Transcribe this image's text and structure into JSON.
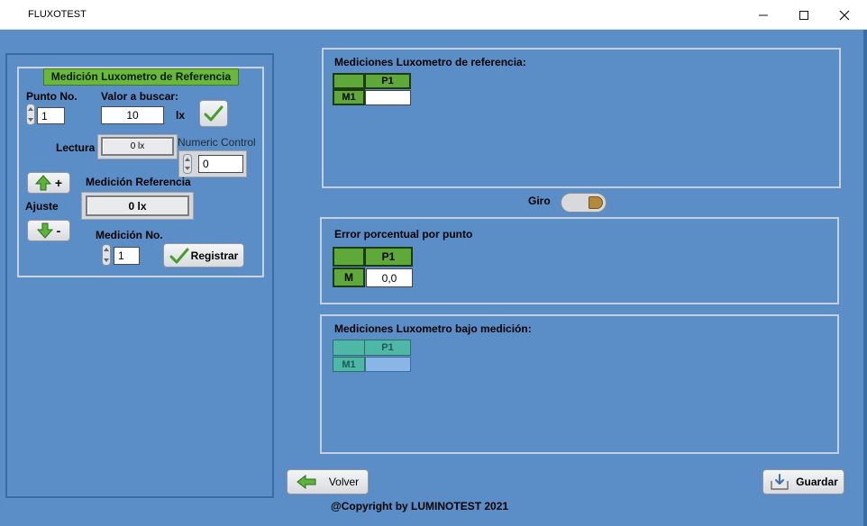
{
  "window": {
    "title": "FLUXOTEST"
  },
  "left": {
    "header": "Medición Luxometro de Referencia",
    "punto_label": "Punto No.",
    "punto_value": "1",
    "valor_label": "Valor a buscar:",
    "valor_value": "10",
    "valor_unit": "lx",
    "lectura_label": "Lectura",
    "lectura_value": "0 lx",
    "numeric_control_label": "Numeric Control",
    "numeric_control_value": "0",
    "medicion_ref_label": "Medición Referencia",
    "medicion_ref_value": "0 lx",
    "ajuste_label": "Ajuste",
    "plus_label": "+",
    "minus_label": "-",
    "medicion_no_label": "Medición No.",
    "medicion_no_value": "1",
    "registrar_label": "Registrar"
  },
  "ref_panel": {
    "title": "Mediciones Luxometro de referencia:",
    "col": "P1",
    "row": "M1",
    "cell": ""
  },
  "giro": {
    "label": "Giro"
  },
  "error_panel": {
    "title": "Error porcentual por punto",
    "col": "P1",
    "row": "M",
    "cell": "0,0"
  },
  "bajo_panel": {
    "title": "Mediciones Luxometro bajo medición:",
    "col": "P1",
    "row": "M1",
    "cell": ""
  },
  "footer": {
    "volver_label": "Volver",
    "guardar_label": "Guardar",
    "copyright": "@Copyright by LUMINOTEST 2021"
  },
  "colors": {
    "background": "#5b8ec7",
    "accent_green": "#6ab83a"
  }
}
